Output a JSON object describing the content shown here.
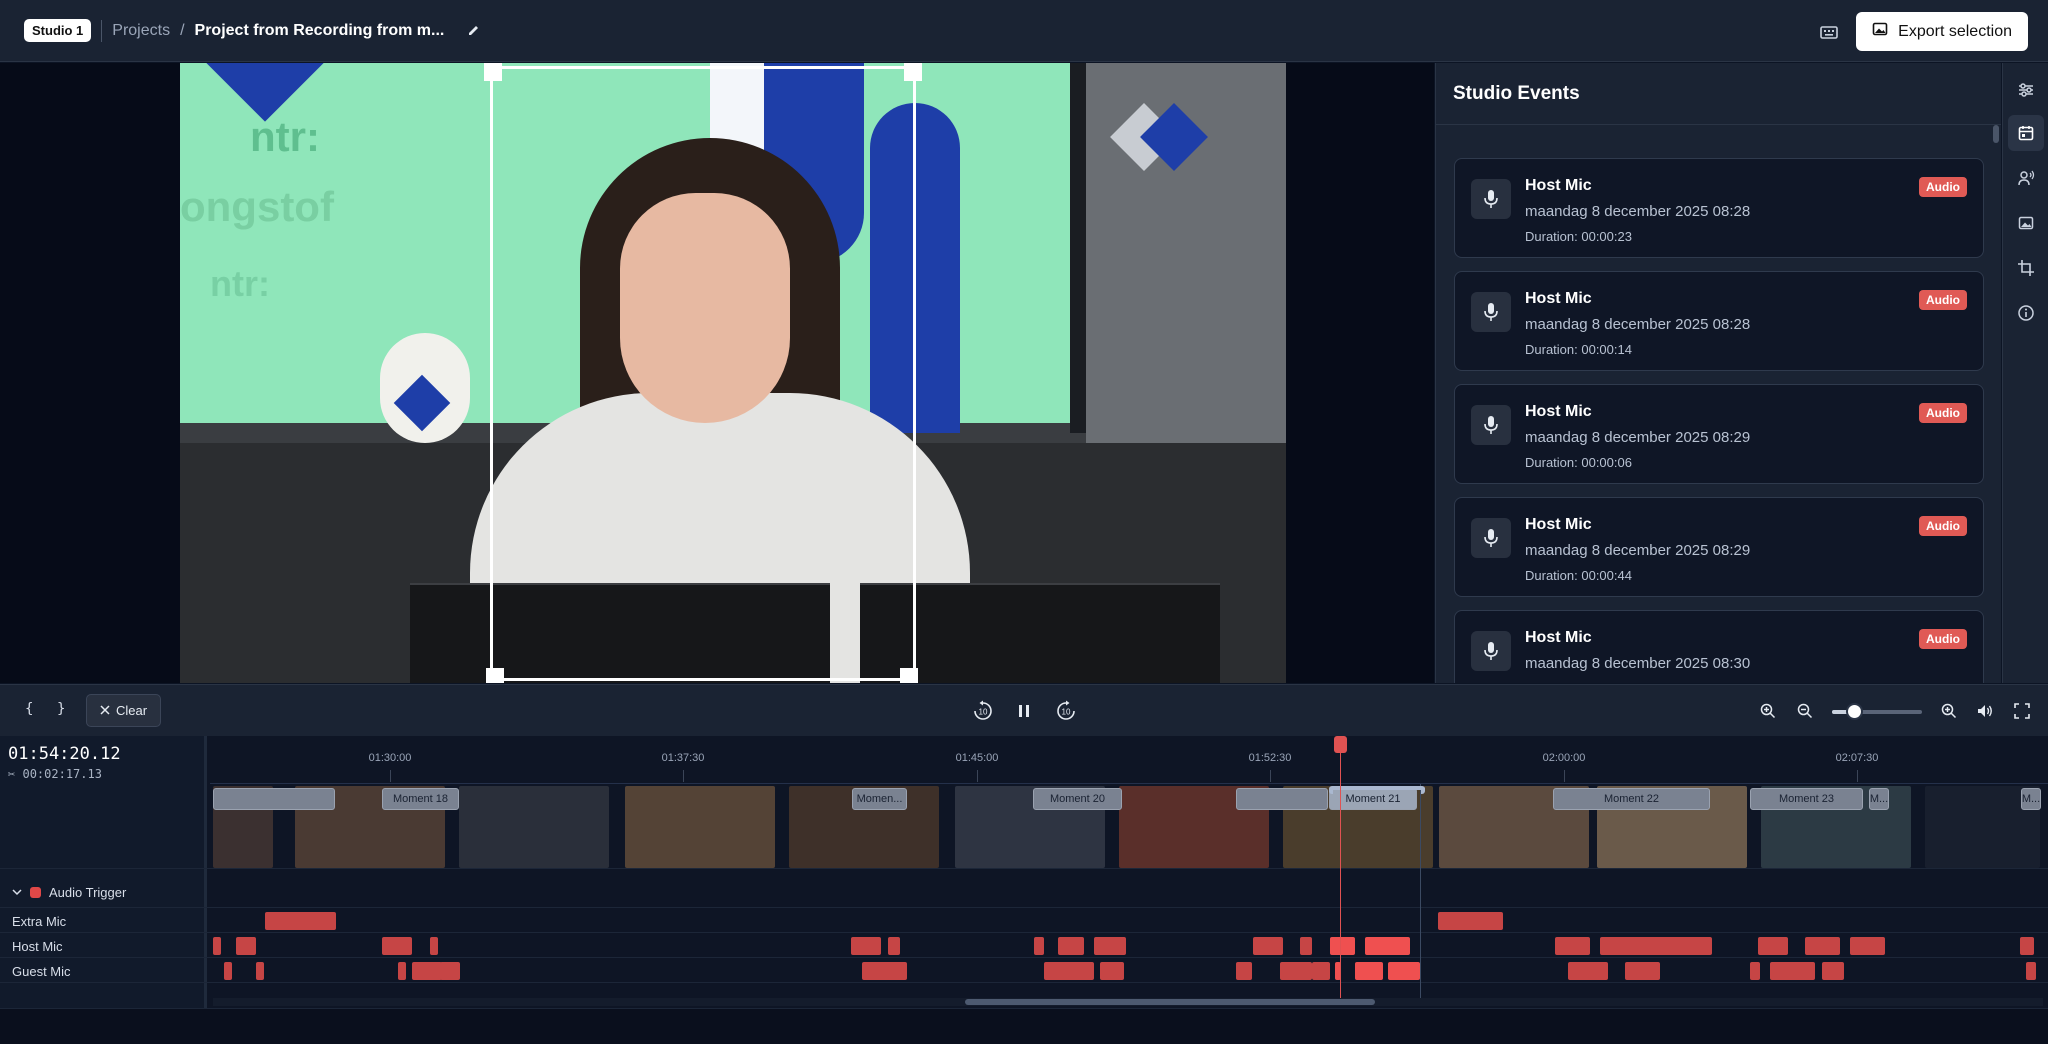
{
  "header": {
    "studio_badge": "Studio 1",
    "breadcrumb_projects": "Projects",
    "breadcrumb_sep": "/",
    "project_title": "Project from Recording from m...",
    "export_label": "Export selection"
  },
  "video": {
    "overlay_text_1": "ntr:",
    "overlay_text_2": "ongstof",
    "overlay_text_3": "ntr:"
  },
  "side_panel": {
    "title": "Studio Events",
    "events": [
      {
        "name": "Host Mic",
        "date": "maandag 8 december 2025 08:28",
        "duration": "Duration: 00:00:23",
        "badge": "Audio"
      },
      {
        "name": "Host Mic",
        "date": "maandag 8 december 2025 08:28",
        "duration": "Duration: 00:00:14",
        "badge": "Audio"
      },
      {
        "name": "Host Mic",
        "date": "maandag 8 december 2025 08:29",
        "duration": "Duration: 00:00:06",
        "badge": "Audio"
      },
      {
        "name": "Host Mic",
        "date": "maandag 8 december 2025 08:29",
        "duration": "Duration: 00:00:44",
        "badge": "Audio"
      },
      {
        "name": "Host Mic",
        "date": "maandag 8 december 2025 08:30",
        "duration": "",
        "badge": "Audio"
      }
    ]
  },
  "controls": {
    "brace_open": "{",
    "brace_close": "}",
    "clear_label": "Clear",
    "skip_back": "10",
    "skip_forward": "10"
  },
  "timeline": {
    "timecode": "01:54:20.12",
    "duration": "00:02:17.13",
    "ticks": [
      "01:30:00",
      "01:37:30",
      "01:45:00",
      "01:52:30",
      "02:00:00",
      "02:07:30"
    ],
    "moments": [
      "Moment 18",
      "Momen...",
      "Moment 20",
      "Moment 21",
      "Moment 22",
      "Moment 23",
      "M...",
      "M..."
    ],
    "group_label": "Audio Trigger",
    "tracks": [
      "Extra Mic",
      "Host Mic",
      "Guest Mic"
    ]
  },
  "colors": {
    "background": "#0c1424",
    "panel": "#1a2333",
    "badge_red": "#e05a55",
    "segment_red": "#c64545",
    "playhead": "#e05252"
  },
  "icons": {
    "edit": "pencil-icon",
    "keyboard": "keyboard-icon",
    "export": "image-icon",
    "mic": "microphone-icon",
    "rail": [
      "sliders-icon",
      "calendar-icon",
      "speaker-person-icon",
      "image-icon",
      "crop-icon",
      "info-icon"
    ]
  }
}
